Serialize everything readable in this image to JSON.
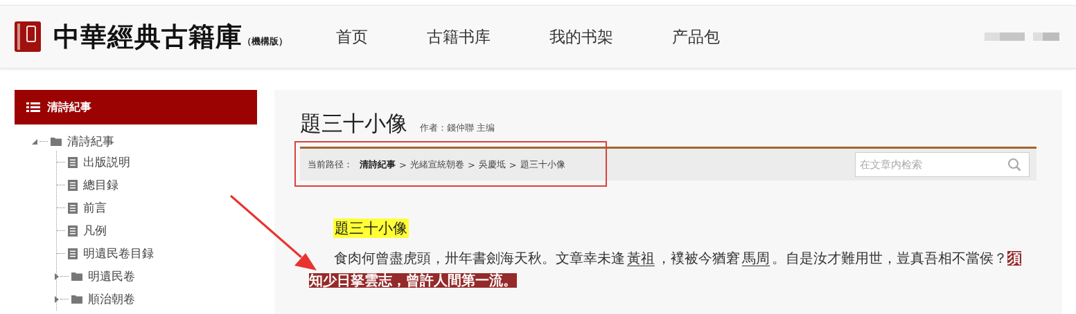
{
  "header": {
    "logo_title": "中華經典古籍庫",
    "logo_edition": "（機構版）",
    "nav": [
      {
        "label": "首页"
      },
      {
        "label": "古籍书库"
      },
      {
        "label": "我的书架"
      },
      {
        "label": "产品包"
      }
    ]
  },
  "sidebar": {
    "title": "清詩紀事",
    "tree": [
      {
        "label": "清詩紀事",
        "kind": "folder",
        "expanded": true,
        "children": [
          {
            "label": " 出版説明",
            "kind": "document"
          },
          {
            "label": "總目録",
            "kind": "document"
          },
          {
            "label": "前言",
            "kind": "document"
          },
          {
            "label": "凡例",
            "kind": "document"
          },
          {
            "label": "明遺民卷目録",
            "kind": "document"
          },
          {
            "label": "明遺民卷",
            "kind": "folder",
            "expanded": false
          },
          {
            "label": "順治朝卷",
            "kind": "folder",
            "expanded": false
          }
        ]
      }
    ]
  },
  "article": {
    "title": "題三十小像",
    "author": "作者：錢仲聯 主编",
    "breadcrumb": {
      "label": "当前路径：",
      "items": [
        {
          "kind": "link",
          "text": "清詩紀事"
        },
        {
          "kind": "separator",
          "text": ">"
        },
        {
          "kind": "link",
          "text": "光緒宣統朝卷"
        },
        {
          "kind": "separator",
          "text": ">"
        },
        {
          "kind": "link",
          "text": "吳慶坻"
        },
        {
          "kind": "separator",
          "text": ">"
        },
        {
          "kind": "link",
          "text": "題三十小像"
        }
      ]
    },
    "search": {
      "placeholder": "在文章内检索"
    },
    "heading": "題三十小像",
    "paragraph": [
      {
        "kind": "text",
        "text": "食肉何曾盡虎頭，卅年書劍海天秋。文章幸未逢"
      },
      {
        "kind": "link",
        "text": "黃祖"
      },
      {
        "kind": "text",
        "text": "，襆被今猶窘"
      },
      {
        "kind": "link",
        "text": "馬周"
      },
      {
        "kind": "text",
        "text": "。自是汝才難用世，豈真吾相不當侯？"
      },
      {
        "kind": "highlight",
        "text": "須知少日拏雲志，曾許人間第一流。"
      }
    ]
  }
}
